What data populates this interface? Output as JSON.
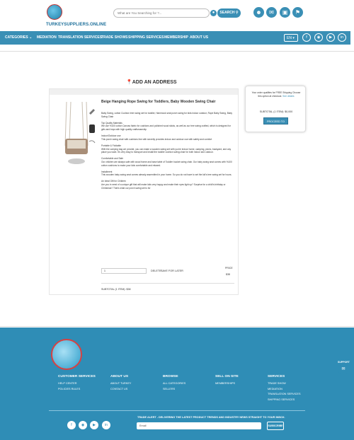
{
  "header": {
    "logo_text": "TURKEYSUPPLIERS.ONLINE",
    "search_placeholder": "What are You Searching for ?...",
    "search_button": "SEARCH",
    "icons": [
      "user-icon",
      "chat-icon",
      "cart-icon",
      "shop-icon"
    ]
  },
  "nav": {
    "categories": "CATEGORIES",
    "items": [
      "MEDIATION",
      "TRANSLATION SERVICES",
      "TRADE SHOWS",
      "SHIPPING SERVICES",
      "MEMBERSHIP",
      "ABOUT US"
    ],
    "lang": "EN",
    "social": [
      "facebook-icon",
      "instagram-icon",
      "youtube-icon",
      "linkedin-icon"
    ]
  },
  "main": {
    "add_address": "ADD AN ADDRESS",
    "product": {
      "title": "Beige Hanging Rope Swing for Toddlers, Baby Wooden Swing Chair",
      "description": [
        "Baby Swing, cotton Cushion tree swing set for toddler, Hammock seat porch swing for kids indoor outdoor, Rope Baby Swing, Baby Swing Chair",
        "Top Quality Materials\nWe use %100 cotton Canvas fabric for cushions and polished wood sticks, as well as our tree swing crafted, which is designed for girls and boys with high quality craftsmanship",
        "Indoor/Outdoor use\nThis porch swing chair with cushions line with secretly provides indoor and outdoor use with safety and comfort",
        "Portable & Foldable\nWith the carrying bag we provide, you can make a wooden swing set with you're indoor home, camping, picnic, backyard, and any place you want. It's very easy to transport and install the toddler cushion swing chair for both indoor and outdoor.",
        "Comfortable and Safe\nOur children are always safe with wood frame and base table of Toddler bucket swing chair. Our baby swing seat comes with %100 cotton cushions to make your kids comfortable and relaxed.",
        "Installment\nThis wooden baby swing seat comes already assembled in your home. So you do not have to set the kid's tree swing set for hours.",
        "An Ideal Gift for Children\nAre you in need of a unique gift that will make kids very happy and make their eyes light up? Surprise for a child's birthday or Christmas? That's what our porch swing set is for"
      ],
      "qty": "1",
      "delete": "DELETE",
      "save_later": "SAVE FOR LATER",
      "price_label": "PRICE",
      "price_value": "$38",
      "subtotal": "SUBTOTAL (1 ITEM): $38"
    },
    "summary": {
      "note": "Your order qualifies for FREE Shipping Choose this option at checkout.",
      "details_link": "See details",
      "subtotal": "SUBTOTAL (1 ITEM): $0,000",
      "button": "PROCEED TO BUY"
    }
  },
  "footer": {
    "columns": [
      {
        "head": "CUSTOMER SERVICES",
        "links": [
          "HELP CENTER",
          "POLICIES RULES"
        ]
      },
      {
        "head": "ABOUT US",
        "links": [
          "ABOUT TURKEY",
          "CONTACT US"
        ]
      },
      {
        "head": "BROWSE",
        "links": [
          "ALL CATEGORIES",
          "SELLERS"
        ]
      },
      {
        "head": "SELL ON SITE",
        "links": [
          "MEMBERSHIPS"
        ]
      },
      {
        "head": "SERVICES",
        "links": [
          "TRADE SHOW",
          "MEDIATION",
          "TRANSLATION SERVICES",
          "SHIPPING SERVICES"
        ]
      }
    ],
    "trade_alert": "TRADE ALERT - DELIVERING THE LATEST PRODUCT TRENDS AND INDUSTRY NEWS STRAIGHT TO YOUR INBOX.",
    "email_placeholder": "Email",
    "subscribe": "SUBSCRIBE",
    "support": "SUPPORT",
    "social": [
      "facebook-icon",
      "instagram-icon",
      "youtube-icon",
      "linkedin-icon"
    ]
  },
  "colors": {
    "primary": "#3a8fb5",
    "footer": "#2f8db6"
  }
}
